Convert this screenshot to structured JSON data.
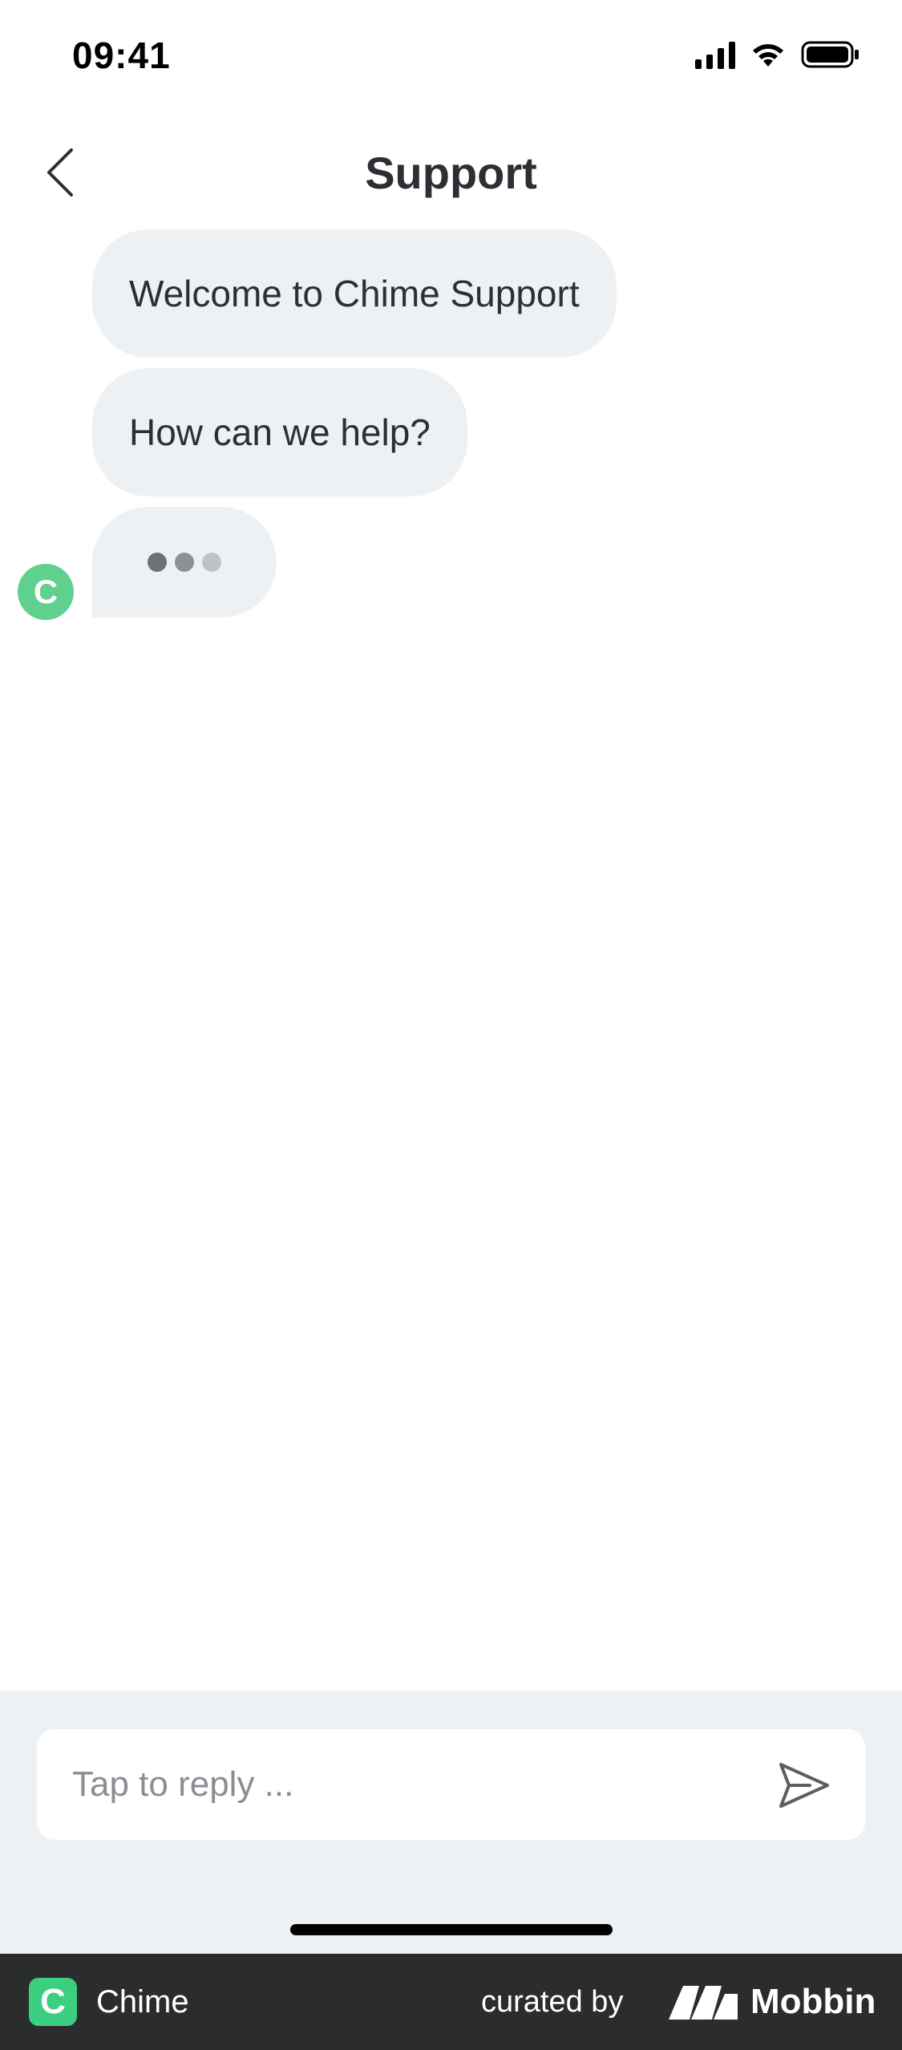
{
  "status_bar": {
    "time": "09:41"
  },
  "header": {
    "title": "Support",
    "back_icon": "chevron-left-icon"
  },
  "chat": {
    "messages": [
      {
        "text": "Welcome to Chime Support"
      },
      {
        "text": "How can we help?"
      }
    ],
    "typing_indicator": {
      "dot_colors": [
        "#6e7276",
        "#8d9195",
        "#bfc3c7"
      ]
    },
    "agent_avatar": {
      "initial": "C",
      "color": "#5fd08d"
    }
  },
  "composer": {
    "placeholder": "Tap to reply ...",
    "value": "",
    "send_icon": "send-icon"
  },
  "footer": {
    "app_logo_letter": "C",
    "app_name": "Chime",
    "curated_by": "curated by",
    "brand": "Mobbin",
    "accent": "#3ccf7f"
  },
  "colors": {
    "bubble": "#eef1f4",
    "text": "#2c2f33",
    "composer_bg": "#eef1f4",
    "footer_bg": "#2b2c2e"
  }
}
